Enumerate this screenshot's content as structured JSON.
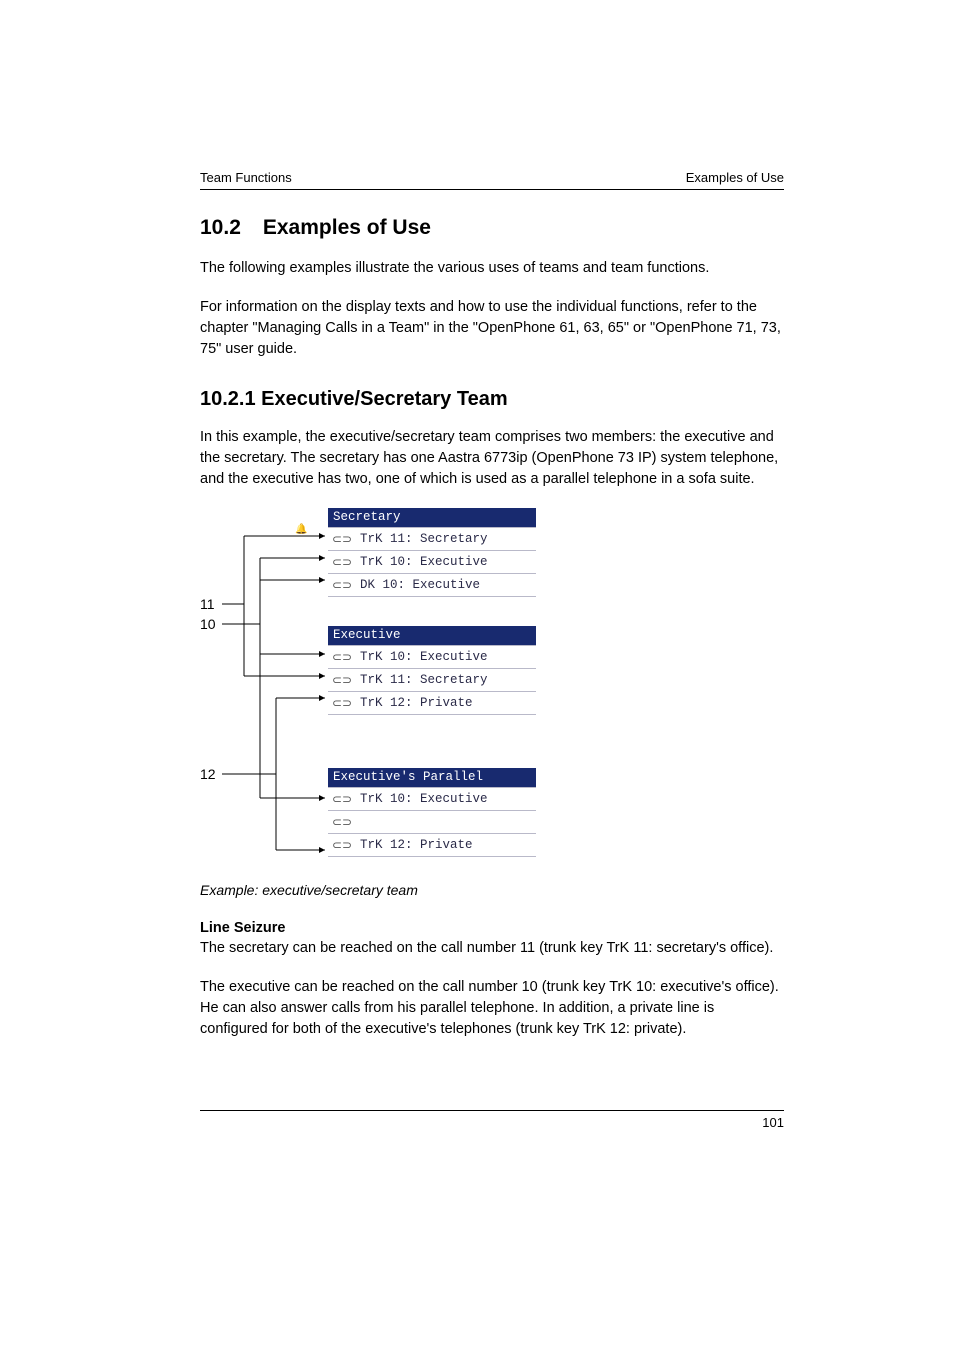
{
  "header": {
    "left": "Team Functions",
    "right": "Examples of Use"
  },
  "section": {
    "num": "10.2",
    "title": "Examples of Use"
  },
  "para1": "The following examples illustrate the various uses of teams and team functions.",
  "para2": "For information on the display texts and how to use the individual functions, refer to the chapter \"Managing Calls in a Team\" in the \"OpenPhone 61, 63, 65\" or \"OpenPhone 71, 73, 75\" user guide.",
  "subsection": "10.2.1 Executive/Secretary Team",
  "para3": "In this example, the executive/secretary team comprises two members: the executive and the secretary. The secretary has one Aastra 6773ip (OpenPhone 73 IP) system telephone, and the executive has two, one of which is used as a parallel telephone in a sofa suite.",
  "diagram": {
    "labels": {
      "a": "11",
      "b": "10",
      "c": "12"
    },
    "cards": {
      "secretary": {
        "title": "Secretary",
        "rows": [
          "TrK 11:  Secretary",
          "TrK 10:  Executive",
          "DK  10:  Executive"
        ]
      },
      "executive": {
        "title": "Executive",
        "rows": [
          "TrK 10:  Executive",
          "TrK 11:  Secretary",
          "TrK 12:  Private"
        ]
      },
      "parallel": {
        "title": "Executive's Parallel",
        "rows": [
          "TrK 10:  Executive",
          "",
          "TrK 12:  Private"
        ]
      }
    }
  },
  "caption": "Example: executive/secretary team",
  "lineseizure": {
    "head": "Line Seizure",
    "p1": "The secretary can be reached on the call number 11 (trunk key TrK 11: secretary's office).",
    "p2": "The executive can be reached on the call number 10 (trunk key TrK 10: executive's office). He can also answer calls from his parallel telephone. In addition, a private line is configured for both of the executive's telephones (trunk key TrK 12: private)."
  },
  "page_number": "101",
  "chart_data": {
    "type": "table",
    "title": "Executive/Secretary team key assignments",
    "series": [
      {
        "name": "Secretary phone",
        "rows": [
          {
            "key": "TrK 11",
            "assignment": "Secretary"
          },
          {
            "key": "TrK 10",
            "assignment": "Executive"
          },
          {
            "key": "DK 10",
            "assignment": "Executive"
          }
        ]
      },
      {
        "name": "Executive phone",
        "rows": [
          {
            "key": "TrK 10",
            "assignment": "Executive"
          },
          {
            "key": "TrK 11",
            "assignment": "Secretary"
          },
          {
            "key": "TrK 12",
            "assignment": "Private"
          }
        ]
      },
      {
        "name": "Executive's Parallel phone",
        "rows": [
          {
            "key": "TrK 10",
            "assignment": "Executive"
          },
          {
            "key": "",
            "assignment": ""
          },
          {
            "key": "TrK 12",
            "assignment": "Private"
          }
        ]
      }
    ],
    "connections": [
      {
        "call_number": 11,
        "to": [
          "Secretary TrK 11",
          "Executive TrK 11"
        ]
      },
      {
        "call_number": 10,
        "to": [
          "Secretary TrK 10",
          "Secretary DK 10",
          "Executive TrK 10",
          "Executive's Parallel TrK 10"
        ]
      },
      {
        "call_number": 12,
        "to": [
          "Executive TrK 12",
          "Executive's Parallel TrK 12"
        ]
      }
    ]
  }
}
